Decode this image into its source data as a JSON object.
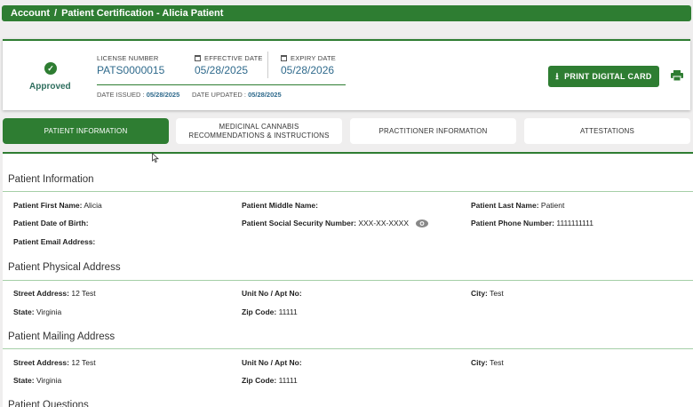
{
  "breadcrumb": {
    "account": "Account",
    "separator": "/",
    "page": "Patient Certification - Alicia Patient"
  },
  "certificate": {
    "status": "Approved",
    "status_icon": "check-circle-icon",
    "license_number_label": "LICENSE NUMBER",
    "license_number": "PATS0000015",
    "effective_date_label": "EFFECTIVE DATE",
    "effective_date": "05/28/2025",
    "expiry_date_label": "EXPIRY DATE",
    "expiry_date": "05/28/2026",
    "date_issued_label": "DATE ISSUED :",
    "date_issued": "05/28/2025",
    "date_updated_label": "DATE UPDATED :",
    "date_updated": "05/28/2025",
    "print_button": "PRINT DIGITAL CARD",
    "print_icon": "printer-icon"
  },
  "tabs": [
    {
      "label": "PATIENT INFORMATION",
      "active": true
    },
    {
      "label": "MEDICINAL CANNABIS RECOMMENDATIONS & INSTRUCTIONS",
      "active": false
    },
    {
      "label": "PRACTITIONER INFORMATION",
      "active": false
    },
    {
      "label": "ATTESTATIONS",
      "active": false
    }
  ],
  "patient_info": {
    "title": "Patient Information",
    "first_name_label": "Patient First Name:",
    "first_name": "Alicia",
    "middle_name_label": "Patient Middle Name:",
    "middle_name": "",
    "last_name_label": "Patient Last Name:",
    "last_name": "Patient",
    "dob_label": "Patient Date of Birth:",
    "dob": "",
    "ssn_label": "Patient Social Security Number:",
    "ssn": "XXX-XX-XXXX",
    "phone_label": "Patient Phone Number:",
    "phone": "1111111111",
    "email_label": "Patient Email Address:",
    "email": ""
  },
  "physical_address": {
    "title": "Patient Physical Address",
    "street_label": "Street Address:",
    "street": "12 Test",
    "unit_label": "Unit No / Apt No:",
    "unit": "",
    "city_label": "City:",
    "city": "Test",
    "state_label": "State:",
    "state": "Virginia",
    "zip_label": "Zip Code:",
    "zip": "11111"
  },
  "mailing_address": {
    "title": "Patient Mailing Address",
    "street_label": "Street Address:",
    "street": "12 Test",
    "unit_label": "Unit No / Apt No:",
    "unit": "",
    "city_label": "City:",
    "city": "Test",
    "state_label": "State:",
    "state": "Virginia",
    "zip_label": "Zip Code:",
    "zip": "11111"
  },
  "questions": {
    "title": "Patient Questions"
  },
  "colors": {
    "brand_green": "#2e7d32",
    "value_blue": "#2f6a8c"
  }
}
